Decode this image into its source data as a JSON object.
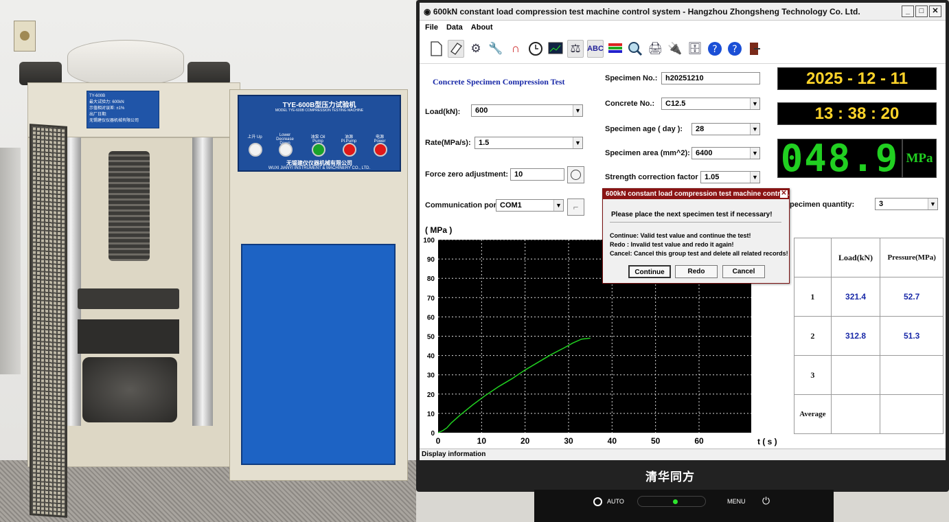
{
  "photo": {
    "panel_title": "TYE-600B型压力试验机",
    "panel_model": "MODEL TYE-600B COMPRESSION TESTING MACHINE",
    "panel_company_cn": "无锡建仪仪器机械有限公司",
    "panel_company_en": "WUXI JIANYI INSTRUMENT & MACHINERY CO., LTD.",
    "panel_buttons": [
      {
        "label": "上升 Up",
        "color": "#f2f2f2"
      },
      {
        "label": "Lower Decrease Down",
        "color": "#f2f2f2"
      },
      {
        "label": "油泵 Oil Pump",
        "color": "#1aa32a"
      },
      {
        "label": "油源 Pl.Pump",
        "color": "#e01818"
      },
      {
        "label": "电源 Power",
        "color": "#e01818"
      }
    ],
    "plate_text": [
      "TY-600B",
      "最大试验力: 600kN",
      "示值相对误差: ±1%",
      "出厂日期:"
    ]
  },
  "window": {
    "title": "600kN constant load compression test machine control system - Hangzhou Zhongsheng Technology Co. Ltd.",
    "controls": [
      "_",
      "□",
      "✕"
    ]
  },
  "menu": [
    "File",
    "Data",
    "About"
  ],
  "toolbar": [
    "new-file-icon",
    "erase-icon",
    "settings-icon",
    "tools-icon",
    "magnet-icon",
    "clock-icon",
    "monitor-icon",
    "calibrate-icon",
    "spell-check-icon",
    "palette-icon",
    "search-icon",
    "print-icon",
    "network-icon",
    "database-icon",
    "help-icon",
    "help-info-icon",
    "exit-icon"
  ],
  "form": {
    "heading": "Concrete Specimen Compression Test",
    "load_label": "Load(kN):",
    "load_value": "600",
    "rate_label": "Rate(MPa/s):",
    "rate_value": "1.5",
    "force_zero_label": "Force zero adjustment:",
    "force_zero_value": "10",
    "comm_port_label": "Communication port:",
    "comm_port_value": "COM1",
    "specimen_no_label": "Specimen No.:",
    "specimen_no_value": "h20251210",
    "concrete_no_label": "Concrete No.:",
    "concrete_no_value": "C12.5",
    "specimen_age_label": "Specimen age ( day ):",
    "specimen_age_value": "28",
    "specimen_area_label": "Specimen area (mm^2):",
    "specimen_area_value": "6400",
    "strength_factor_label": "Strength correction factor :",
    "strength_factor_value": "1.05",
    "specimen_qty_label": "pecimen quantity:",
    "specimen_qty_value": "3"
  },
  "display": {
    "date": "2025 - 12 - 11",
    "time": "13 : 38 : 20",
    "pressure": "048.9",
    "unit": "MPa"
  },
  "chart_data": {
    "type": "line",
    "ylabel": "( MPa )",
    "xlabel": "t ( s )",
    "xlim": [
      0,
      72
    ],
    "ylim": [
      0,
      100
    ],
    "xticks": [
      0,
      10,
      20,
      30,
      40,
      50,
      60
    ],
    "yticks": [
      0,
      10,
      20,
      30,
      40,
      50,
      60,
      70,
      80,
      90,
      100
    ],
    "grid": true,
    "series": [
      {
        "color": "#21d021",
        "x": [
          0,
          1,
          2,
          3,
          5,
          8,
          11,
          14,
          17,
          20,
          23,
          26,
          29,
          31,
          33,
          35
        ],
        "y": [
          0,
          1,
          2.5,
          5,
          9,
          14.5,
          19.5,
          24,
          28,
          32.5,
          36.5,
          40.5,
          44,
          46.5,
          48.5,
          49
        ]
      }
    ]
  },
  "results_table": {
    "headers": [
      "",
      "Load(kN)",
      "Pressure(MPa)"
    ],
    "rows": [
      {
        "label": "1",
        "load": "321.4",
        "pressure": "52.7"
      },
      {
        "label": "2",
        "load": "312.8",
        "pressure": "51.3"
      },
      {
        "label": "3",
        "load": "",
        "pressure": ""
      },
      {
        "label": "Average",
        "load": "",
        "pressure": ""
      }
    ]
  },
  "dialog": {
    "title": "600kN constant load compression test machine control ...",
    "message": "Please place the next specimen test if necessary!",
    "continue_text": "Continue:   Valid test value and continue the test!",
    "redo_text": "Redo  : Invalid test value and redo it again!",
    "cancel_text": "Cancel: Cancel this group test and delete all related records!",
    "buttons": [
      "Continue",
      "Redo",
      "Cancel"
    ]
  },
  "status": "Display information",
  "monitor": {
    "brand": "清华同方",
    "auto_label": "AUTO",
    "menu_label": "MENU"
  }
}
